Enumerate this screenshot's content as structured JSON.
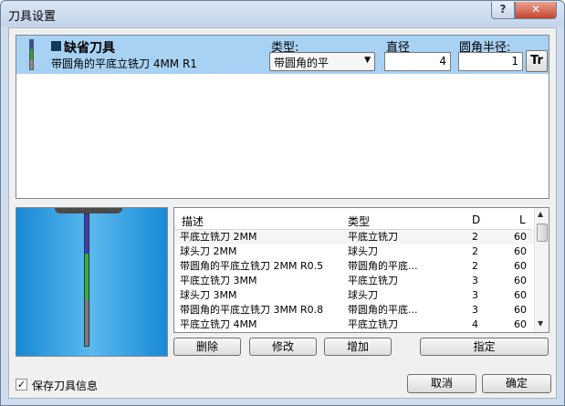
{
  "window": {
    "title": "刀具设置",
    "help_label": "?",
    "close_label": "✕"
  },
  "tool": {
    "name": "缺省刀具",
    "description": "带圆角的平底立铣刀 4MM R1",
    "type_label": "类型:",
    "type_value": "带圆角的平",
    "diameter_label": "直径",
    "diameter_value": "4",
    "radius_label": "圆角半径:",
    "radius_value": "1",
    "tool_icon": "Tr"
  },
  "table": {
    "headers": [
      "描述",
      "类型",
      "D",
      "L"
    ],
    "rows": [
      {
        "desc": "平底立铣刀 2MM",
        "type": "平底立铣刀",
        "d": "2",
        "l": "60"
      },
      {
        "desc": "球头刀 2MM",
        "type": "球头刀",
        "d": "2",
        "l": "60"
      },
      {
        "desc": "带圆角的平底立铣刀 2MM R0.5",
        "type": "带圆角的平底...",
        "d": "2",
        "l": "60"
      },
      {
        "desc": "平底立铣刀 3MM",
        "type": "平底立铣刀",
        "d": "3",
        "l": "60"
      },
      {
        "desc": "球头刀 3MM",
        "type": "球头刀",
        "d": "3",
        "l": "60"
      },
      {
        "desc": "带圆角的平底立铣刀 3MM R0.8",
        "type": "带圆角的平底...",
        "d": "3",
        "l": "60"
      },
      {
        "desc": "平底立铣刀 4MM",
        "type": "平底立铣刀",
        "d": "4",
        "l": "60"
      }
    ]
  },
  "buttons": {
    "delete": "删除",
    "modify": "修改",
    "add": "增加",
    "assign": "指定",
    "cancel": "取消",
    "ok": "确定"
  },
  "save_info": {
    "label": "保存刀具信息",
    "checked": true
  }
}
